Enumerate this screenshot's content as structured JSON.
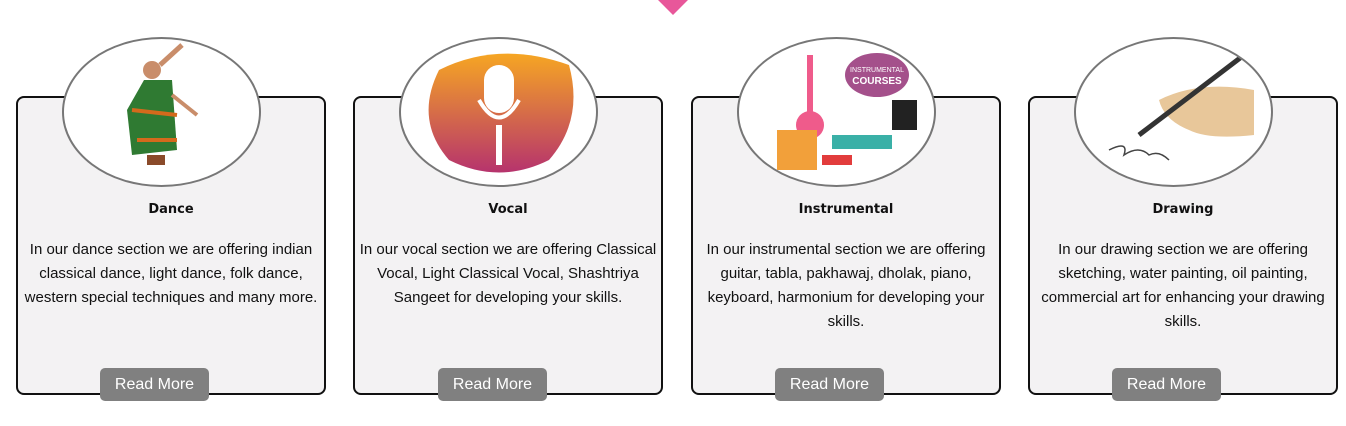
{
  "cards": [
    {
      "title": "Dance",
      "description": "In our dance section we are offering indian classical dance, light dance, folk dance, western special techniques and many more.",
      "button": "Read More",
      "image": "dancer-image"
    },
    {
      "title": "Vocal",
      "description": "In our vocal section we are offering Classical Vocal, Light Classical Vocal, Shashtriya Sangeet for developing your skills.",
      "button": "Read More",
      "image": "microphone-image"
    },
    {
      "title": "Instrumental",
      "description": "In our instrumental section we are offering guitar, tabla, pakhawaj, dholak, piano, keyboard, harmonium for developing your skills.",
      "button": "Read More",
      "image": "instruments-image",
      "image_text": "INSTRUMENTAL COURSES"
    },
    {
      "title": "Drawing",
      "description": "In our drawing section we are offering sketching, water painting, oil painting, commercial art for enhancing your drawing skills.",
      "button": "Read More",
      "image": "drawing-hand-image"
    }
  ],
  "accent": "#e8579a"
}
